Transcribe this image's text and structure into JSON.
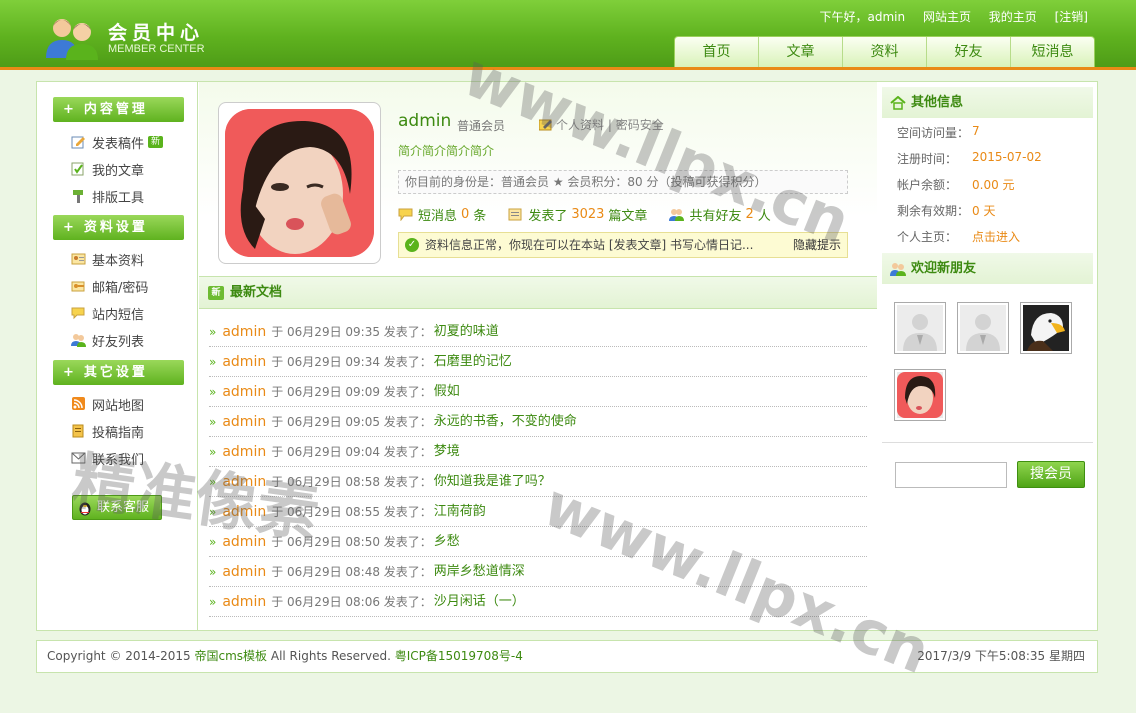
{
  "header": {
    "logo_cn": "会员中心",
    "logo_en": "MEMBER CENTER",
    "greeting": "下午好，admin",
    "links": [
      "网站主页",
      "我的主页",
      "[注销]"
    ],
    "nav": [
      "首页",
      "文章",
      "资料",
      "好友",
      "短消息"
    ],
    "accent_color": "#5fb21f",
    "bar_color": "#e98a16"
  },
  "sidebar": {
    "sections": [
      {
        "title": "内容管理",
        "items": [
          {
            "label": "发表稿件",
            "badge": "新",
            "icon": "edit-icon"
          },
          {
            "label": "我的文章",
            "icon": "article-icon"
          },
          {
            "label": "排版工具",
            "icon": "tool-icon"
          }
        ]
      },
      {
        "title": "资料设置",
        "items": [
          {
            "label": "基本资料",
            "icon": "profile-card-icon"
          },
          {
            "label": "邮箱/密码",
            "icon": "key-icon"
          },
          {
            "label": "站内短信",
            "icon": "message-icon"
          },
          {
            "label": "好友列表",
            "icon": "friends-icon"
          }
        ]
      },
      {
        "title": "其它设置",
        "items": [
          {
            "label": "网站地图",
            "icon": "rss-icon"
          },
          {
            "label": "投稿指南",
            "icon": "guide-icon"
          },
          {
            "label": "联系我们",
            "icon": "mail-icon"
          }
        ]
      }
    ],
    "kefu": "联系客服"
  },
  "profile": {
    "username": "admin",
    "group": "普通会员",
    "link1": "个人资料",
    "sep": "|",
    "link2": "密码安全",
    "intro": "简介简介简介简介",
    "identity": "你目前的身份是：普通会员 ★ 会员积分：80 分（投稿可获得积分）",
    "messages_label": "短消息",
    "messages_count": "0",
    "messages_unit": "条",
    "posts_label": "发表了",
    "posts_count": "3023",
    "posts_unit": "篇文章",
    "friends_label": "共有好友",
    "friends_count": "2",
    "friends_unit": "人",
    "notice": "资料信息正常，你现在可以在本站 [发表文章] 书写心情日记...",
    "notice_hide": "隐藏提示"
  },
  "docs": {
    "title": "最新文档",
    "title_icon": "新",
    "rows": [
      {
        "author": "admin",
        "time": "于 06月29日 09:35 发表了：",
        "title": "初夏的味道"
      },
      {
        "author": "admin",
        "time": "于 06月29日 09:34 发表了：",
        "title": "石磨里的记忆"
      },
      {
        "author": "admin",
        "time": "于 06月29日 09:09 发表了：",
        "title": "假如"
      },
      {
        "author": "admin",
        "time": "于 06月29日 09:05 发表了：",
        "title": "永远的书香，不变的使命"
      },
      {
        "author": "admin",
        "time": "于 06月29日 09:04 发表了：",
        "title": "梦境"
      },
      {
        "author": "admin",
        "time": "于 06月29日 08:58 发表了：",
        "title": "你知道我是谁了吗？"
      },
      {
        "author": "admin",
        "time": "于 06月29日 08:55 发表了：",
        "title": "江南荷韵"
      },
      {
        "author": "admin",
        "time": "于 06月29日 08:50 发表了：",
        "title": "乡愁"
      },
      {
        "author": "admin",
        "time": "于 06月29日 08:48 发表了：",
        "title": "两岸乡愁道情深"
      },
      {
        "author": "admin",
        "time": "于 06月29日 08:06 发表了：",
        "title": "沙月闲话（一）"
      }
    ]
  },
  "other_info": {
    "title": "其他信息",
    "rows": [
      {
        "label": "空间访问量：",
        "value": "7"
      },
      {
        "label": "注册时间：",
        "value": "2015-07-02"
      },
      {
        "label": "帐户余额：",
        "value": "0.00 元"
      },
      {
        "label": "剩余有效期：",
        "value": "0 天"
      },
      {
        "label": "个人主页：",
        "value": "点击进入"
      }
    ]
  },
  "new_friends": {
    "title": "欢迎新朋友",
    "items": [
      "default-avatar",
      "default-avatar",
      "eagle-avatar",
      "girl-avatar"
    ]
  },
  "search": {
    "button": "搜会员",
    "placeholder": ""
  },
  "footer": {
    "copyright": "Copyright © 2014-2015 ",
    "brand": "帝国cms模板",
    "rights": " All Rights Reserved. ",
    "icp": "粤ICP备15019708号-4",
    "datetime": "2017/3/9 下午5:08:35 星期四"
  },
  "watermark": {
    "line1": "www.llpx.cn",
    "line2": "精准像素",
    "line3": "www.llpx.cn"
  }
}
